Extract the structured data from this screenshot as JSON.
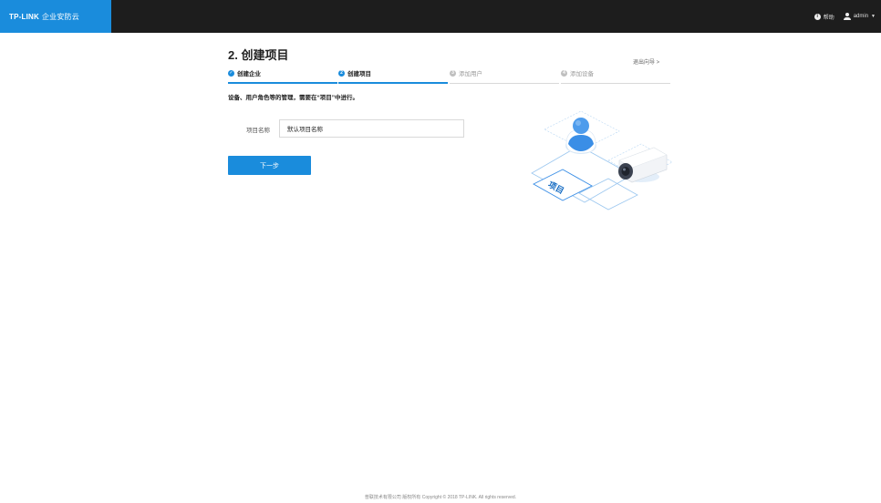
{
  "header": {
    "brand": "TP-LINK",
    "brand_sub": "企业安防云",
    "help_label": "帮助",
    "user_label": "admin"
  },
  "page": {
    "title": "2. 创建项目",
    "exit_label": "退出向导 >"
  },
  "steps": [
    {
      "index": "✓",
      "label": "创建企业",
      "state": "done"
    },
    {
      "index": "2",
      "label": "创建项目",
      "state": "active"
    },
    {
      "index": "3",
      "label": "添加用户",
      "state": "pending"
    },
    {
      "index": "4",
      "label": "添加设备",
      "state": "pending"
    }
  ],
  "hint": "设备、用户角色等的管理，需要在“项目”中进行。",
  "form": {
    "project_name_label": "项目名称",
    "project_name_value": "默认项目名称"
  },
  "next_button": "下一步",
  "illustration": {
    "label": "项目"
  },
  "footer": "普联技术有限公司 版权所有 Copyright © 2018 TP-LINK. All rights reserved.",
  "colors": {
    "accent": "#1a8cdc",
    "topbar": "#1d1d1d"
  }
}
